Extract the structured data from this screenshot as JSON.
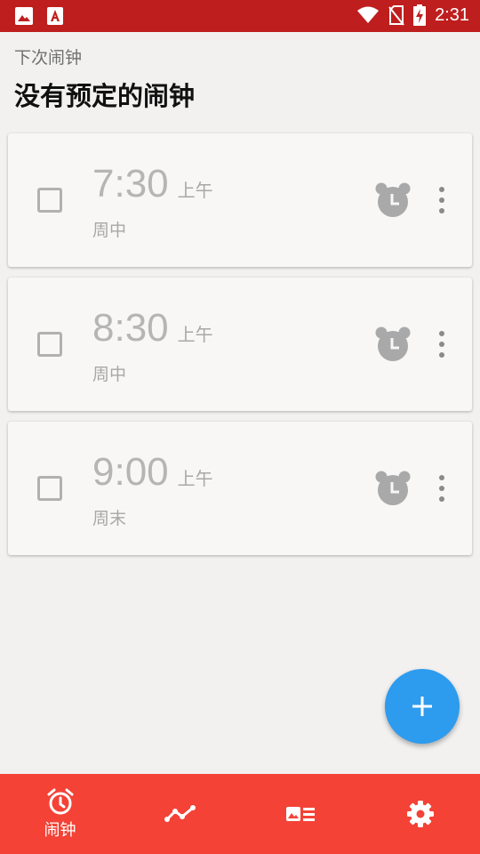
{
  "status_bar": {
    "time": "2:31",
    "icons": [
      "image-icon",
      "pdf-app-icon",
      "wifi-icon",
      "no-sim-icon",
      "battery-charging-icon"
    ]
  },
  "header": {
    "subtitle": "下次闹钟",
    "title": "没有预定的闹钟"
  },
  "alarms": [
    {
      "time": "7:30",
      "ampm": "上午",
      "days": "周中",
      "enabled": false
    },
    {
      "time": "8:30",
      "ampm": "上午",
      "days": "周中",
      "enabled": false
    },
    {
      "time": "9:00",
      "ampm": "上午",
      "days": "周末",
      "enabled": false
    }
  ],
  "fab": {
    "icon": "plus-icon"
  },
  "bottom_nav": {
    "items": [
      {
        "icon": "alarm-clock-icon",
        "label": "闹钟",
        "active": true
      },
      {
        "icon": "chart-line-icon",
        "label": "",
        "active": false
      },
      {
        "icon": "image-list-icon",
        "label": "",
        "active": false
      },
      {
        "icon": "gear-icon",
        "label": "",
        "active": false
      }
    ]
  },
  "colors": {
    "status_bar": "#bf1e1e",
    "bottom_nav": "#f44236",
    "fab": "#2d9bee",
    "background": "#f2f1f0"
  }
}
